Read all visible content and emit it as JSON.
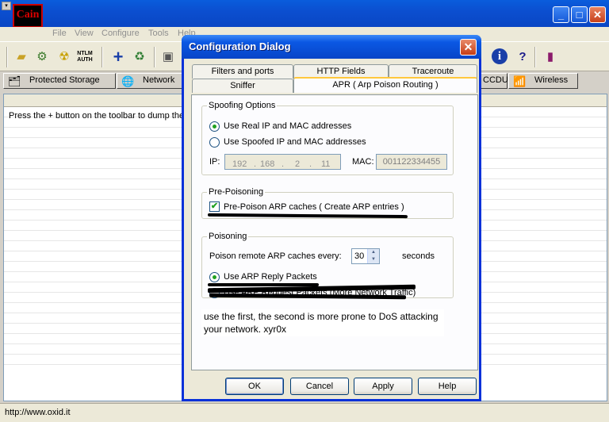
{
  "app": {
    "logo_text": "Cain",
    "menu": [
      "File",
      "View",
      "Configure",
      "Tools",
      "Help"
    ],
    "tabs": [
      "Protected Storage",
      "Network",
      "CCDU",
      "Wireless"
    ],
    "list_hint": "Press the + button on the toolbar to dump the",
    "status": "http://www.oxid.it",
    "window_buttons": {
      "minimize": "_",
      "maximize": "□",
      "close": "✕"
    }
  },
  "toolbar_icons": [
    "folder-icon",
    "network-scan-icon",
    "radiation-icon",
    "ntlm-auth-icon",
    "plus-icon",
    "recycle-icon",
    "config-icon",
    "info-icon",
    "help-icon",
    "exit-icon"
  ],
  "toolbar_ntlm_label": "NTLM AUTH",
  "dialog": {
    "title": "Configuration Dialog",
    "close": "✕",
    "tabs_row1": [
      "Filters and ports",
      "HTTP Fields",
      "Traceroute"
    ],
    "tabs_row2": [
      "Sniffer",
      "APR ( Arp Poison Routing )"
    ],
    "spoofing": {
      "legend": "Spoofing Options",
      "opt_real": "Use Real IP and MAC addresses",
      "opt_spoofed": "Use Spoofed IP and MAC addresses",
      "ip_label": "IP:",
      "ip": [
        "192",
        "168",
        "2",
        "11"
      ],
      "mac_label": "MAC:",
      "mac": "001122334455"
    },
    "prepoison": {
      "legend": "Pre-Poisoning",
      "checkbox_label": "Pre-Poison ARP caches ( Create ARP entries )",
      "checked": true
    },
    "poisoning": {
      "legend": "Poisoning",
      "every_label": "Poison remote ARP caches every:",
      "seconds_value": "30",
      "seconds_label": "seconds",
      "opt_reply": "Use ARP Reply Packets",
      "opt_request": "Use ARP Request Packets (More Network Traffic)"
    },
    "note": "use the first, the second is more prone to DoS attacking your network. xyr0x",
    "buttons": {
      "ok": "OK",
      "cancel": "Cancel",
      "apply": "Apply",
      "help": "Help"
    }
  }
}
